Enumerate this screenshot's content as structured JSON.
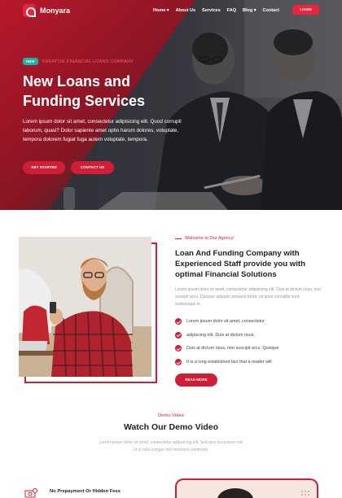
{
  "brand": {
    "name": "Monyara",
    "accent": "#cf1e37",
    "badge_color": "#18b6a3"
  },
  "nav": {
    "items": [
      "Home ▾",
      "About Us",
      "Services",
      "FAQ",
      "Blog ▾",
      "Contact"
    ],
    "login": "LOGIN"
  },
  "hero": {
    "badge": "NEW",
    "kicker": "CREATIVE FINANCIAL LOANS COMPANY",
    "title_line1": "New Loans and",
    "title_line2": "Funding Services",
    "description": "Lorem ipsum dolor sit amet, consectetur adipisicing elit. Quod corrupti laborum, quasi? Dolor sapiente amet optio harum dolores, voluptate, tempora dolorem fugiat fuga autem voluptate, tempora.",
    "btn_start": "GET STARTED",
    "btn_contact": "CONTACT US"
  },
  "about": {
    "kicker": "Welcome to Our Agency!",
    "title": "Loan And Funding Company with Experienced Staff provide you with optimal Financial Solutions",
    "description": "Lorem ipsum dolor sit amet, consectetur adipisicing elit. Duis at dictum risus, non suscipit arcu. Quisque aliquam posuere tortor, sit amet convallis nunc scelerisque in.",
    "features": [
      "Lorem ipsum dolor sit amet, consectetur",
      "adipiscing elit. Duis at dictum risus,",
      "Duis at dictum risus, non suscipit arcu. Quisque",
      "It is a long established fact that a reader will"
    ],
    "btn_more": "READ MORE"
  },
  "demo": {
    "kicker": "Demo Video",
    "title": "Watch Our Demo Video",
    "description": "Lorem ipsum dolor sit amet, consectetur adipisicing elit. Sed quis accumsan nisi Ut ut felis congue nisl hendrerit commodo."
  },
  "bottom": {
    "feature_title": "No Prepayment Or Hidden Fees"
  }
}
